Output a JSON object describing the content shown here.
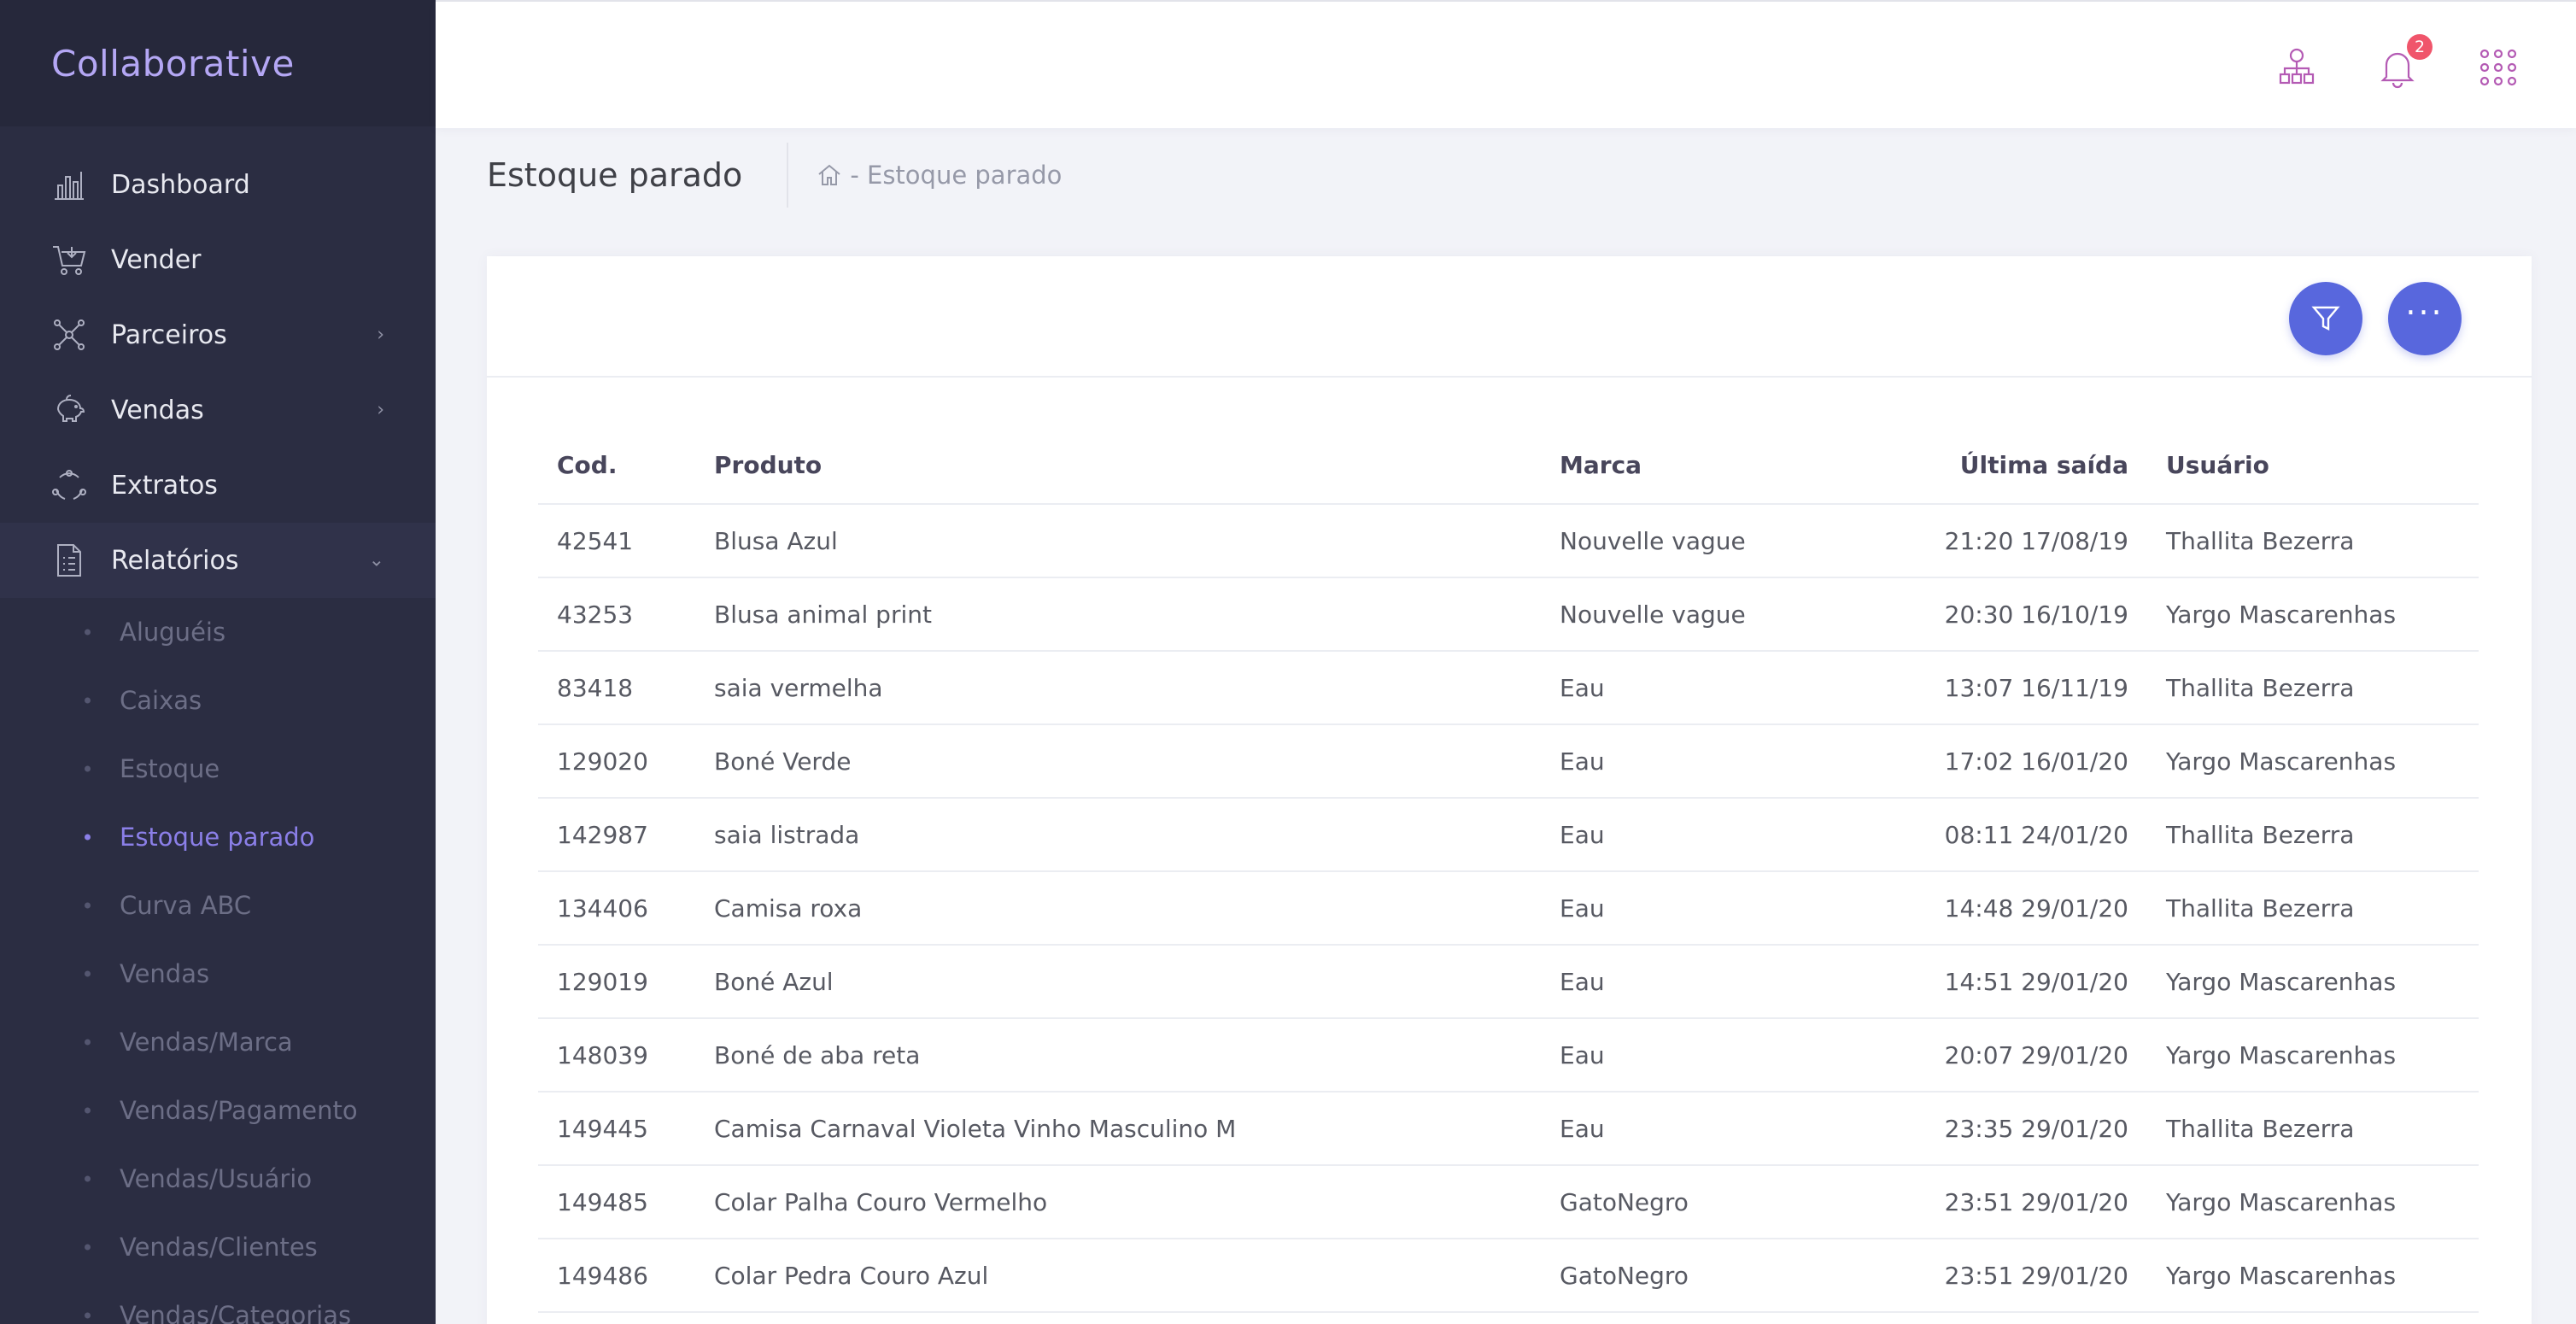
{
  "app": {
    "brand": "Collaborative"
  },
  "sidebar": {
    "items": [
      {
        "label": "Dashboard",
        "icon": "bar-chart-icon"
      },
      {
        "label": "Vender",
        "icon": "cart-icon"
      },
      {
        "label": "Parceiros",
        "icon": "network-icon",
        "arrow": "›"
      },
      {
        "label": "Vendas",
        "icon": "piggy-bank-icon",
        "arrow": "›"
      },
      {
        "label": "Extratos",
        "icon": "cycle-icon"
      },
      {
        "label": "Relatórios",
        "icon": "document-icon",
        "arrow": "⌄"
      }
    ],
    "subitems": [
      "Aluguéis",
      "Caixas",
      "Estoque",
      "Estoque parado",
      "Curva ABC",
      "Vendas",
      "Vendas/Marca",
      "Vendas/Pagamento",
      "Vendas/Usuário",
      "Vendas/Clientes",
      "Vendas/Categorias"
    ],
    "active_subitem": "Estoque parado"
  },
  "topbar": {
    "icons": [
      "org-chart-icon",
      "bell-icon",
      "apps-grid-icon"
    ],
    "notification_count": "2",
    "icon_color": "#b45bb4"
  },
  "page": {
    "title": "Estoque parado",
    "breadcrumb": "- Estoque parado"
  },
  "toolbar": {
    "filter_icon": "filter-icon",
    "more_label": "···",
    "accent": "#5867dd"
  },
  "table": {
    "headers": [
      "Cod.",
      "Produto",
      "Marca",
      "Última saída",
      "Usuário"
    ],
    "rows": [
      [
        "42541",
        "Blusa Azul",
        "Nouvelle vague",
        "21:20 17/08/19",
        "Thallita Bezerra"
      ],
      [
        "43253",
        "Blusa animal print",
        "Nouvelle vague",
        "20:30 16/10/19",
        "Yargo Mascarenhas"
      ],
      [
        "83418",
        "saia vermelha",
        "Eau",
        "13:07 16/11/19",
        "Thallita Bezerra"
      ],
      [
        "129020",
        "Boné Verde",
        "Eau",
        "17:02 16/01/20",
        "Yargo Mascarenhas"
      ],
      [
        "142987",
        "saia listrada",
        "Eau",
        "08:11 24/01/20",
        "Thallita Bezerra"
      ],
      [
        "134406",
        "Camisa roxa",
        "Eau",
        "14:48 29/01/20",
        "Thallita Bezerra"
      ],
      [
        "129019",
        "Boné Azul",
        "Eau",
        "14:51 29/01/20",
        "Yargo Mascarenhas"
      ],
      [
        "148039",
        "Boné de aba reta",
        "Eau",
        "20:07 29/01/20",
        "Yargo Mascarenhas"
      ],
      [
        "149445",
        "Camisa Carnaval Violeta Vinho Masculino M",
        "Eau",
        "23:35 29/01/20",
        "Thallita Bezerra"
      ],
      [
        "149485",
        "Colar Palha Couro Vermelho",
        "GatoNegro",
        "23:51 29/01/20",
        "Yargo Mascarenhas"
      ],
      [
        "149486",
        "Colar Pedra Couro Azul",
        "GatoNegro",
        "23:51 29/01/20",
        "Yargo Mascarenhas"
      ]
    ]
  }
}
